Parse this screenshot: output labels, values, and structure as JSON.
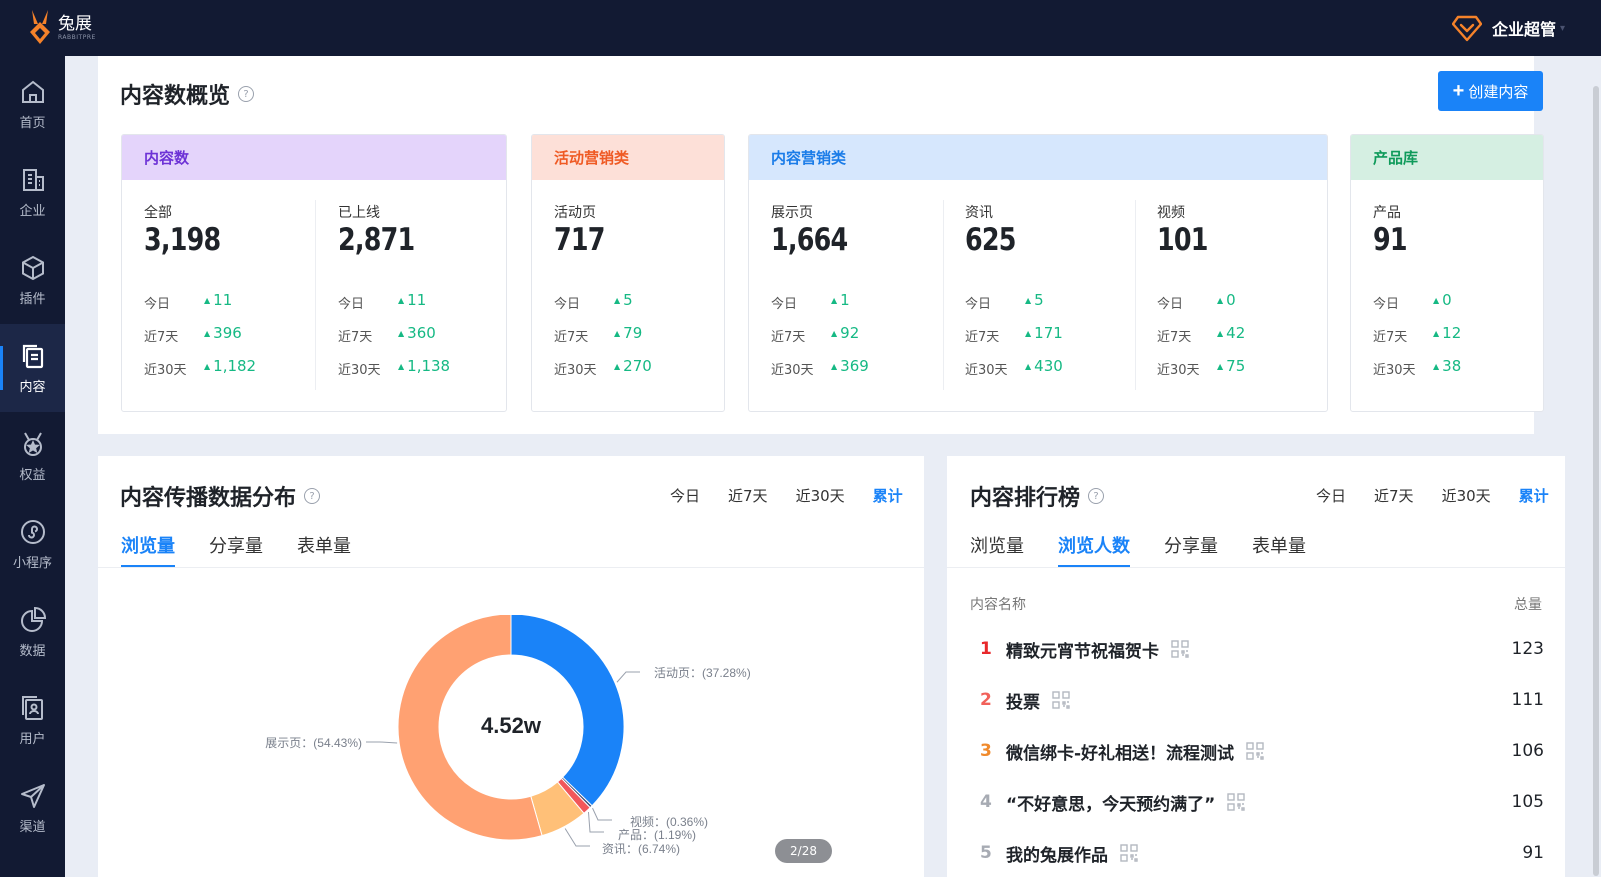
{
  "app": {
    "logo_cn": "兔展",
    "logo_en": "RABBITPRE",
    "user_role": "企业超管",
    "caret": "▾"
  },
  "sidebar": {
    "items": [
      {
        "label": "首页",
        "icon": "home-icon"
      },
      {
        "label": "企业",
        "icon": "building-icon"
      },
      {
        "label": "插件",
        "icon": "cube-icon"
      },
      {
        "label": "内容",
        "icon": "copy-icon",
        "active": true
      },
      {
        "label": "权益",
        "icon": "medal-icon"
      },
      {
        "label": "小程序",
        "icon": "miniprogram-icon"
      },
      {
        "label": "数据",
        "icon": "pie-icon"
      },
      {
        "label": "用户",
        "icon": "user-doc-icon"
      },
      {
        "label": "渠道",
        "icon": "send-icon"
      }
    ]
  },
  "overview": {
    "title": "内容数概览",
    "help": "?",
    "create_label": "创建内容",
    "create_plus": "+",
    "groups": [
      {
        "name": "内容数",
        "head_bg": "#e4d4fb",
        "head_color": "#6d32d6",
        "metrics": [
          {
            "label": "全部",
            "value": "3,198",
            "today": "11",
            "d7": "396",
            "d30": "1,182"
          },
          {
            "label": "已上线",
            "value": "2,871",
            "today": "11",
            "d7": "360",
            "d30": "1,138"
          }
        ]
      },
      {
        "name": "活动营销类",
        "head_bg": "#fde0d8",
        "head_color": "#ef5a24",
        "metrics": [
          {
            "label": "活动页",
            "value": "717",
            "today": "5",
            "d7": "79",
            "d30": "270"
          }
        ]
      },
      {
        "name": "内容营销类",
        "head_bg": "#d6e7fd",
        "head_color": "#1a7ce8",
        "metrics": [
          {
            "label": "展示页",
            "value": "1,664",
            "today": "1",
            "d7": "92",
            "d30": "369"
          },
          {
            "label": "资讯",
            "value": "625",
            "today": "5",
            "d7": "171",
            "d30": "430"
          },
          {
            "label": "视频",
            "value": "101",
            "today": "0",
            "d7": "42",
            "d30": "75"
          }
        ]
      },
      {
        "name": "产品库",
        "head_bg": "#d5efe2",
        "head_color": "#0e9a5a",
        "metrics": [
          {
            "label": "产品",
            "value": "91",
            "today": "0",
            "d7": "12",
            "d30": "38"
          }
        ]
      }
    ],
    "row_labels": {
      "today": "今日",
      "d7": "近7天",
      "d30": "近30天"
    }
  },
  "spread": {
    "title": "内容传播数据分布",
    "periods": [
      "今日",
      "近7天",
      "近30天",
      "累计"
    ],
    "selected_period": "累计",
    "tabs": [
      "浏览量",
      "分享量",
      "表单量"
    ],
    "selected_tab": "浏览量",
    "center_value": "4.52w",
    "pager": "2/28"
  },
  "chart_data": {
    "type": "pie",
    "title": "",
    "slices": [
      {
        "name": "活动页",
        "label": "活动页：(37.28%)",
        "value": 37.28,
        "color": "#1a83f8"
      },
      {
        "name": "视频",
        "label": "视频：(0.36%)",
        "value": 0.36,
        "color": "#3a4a73"
      },
      {
        "name": "产品",
        "label": "产品：(1.19%)",
        "value": 1.19,
        "color": "#f2575a"
      },
      {
        "name": "资讯",
        "label": "资讯：(6.74%)",
        "value": 6.74,
        "color": "#ffc078"
      },
      {
        "name": "展示页",
        "label": "展示页：(54.43%)",
        "value": 54.43,
        "color": "#ffa172"
      }
    ]
  },
  "rank": {
    "title": "内容排行榜",
    "periods": [
      "今日",
      "近7天",
      "近30天",
      "累计"
    ],
    "selected_period": "累计",
    "tabs": [
      "浏览量",
      "浏览人数",
      "分享量",
      "表单量"
    ],
    "selected_tab": "浏览人数",
    "col_name": "内容名称",
    "col_total": "总量",
    "rows": [
      {
        "rank": "1",
        "title": "精致元宵节祝福贺卡",
        "value": "123",
        "color": "#e8282b"
      },
      {
        "rank": "2",
        "title": "投票",
        "value": "111",
        "color": "#f1615a"
      },
      {
        "rank": "3",
        "title": "微信绑卡-好礼相送！流程测试",
        "value": "106",
        "color": "#f08a2c"
      },
      {
        "rank": "4",
        "title": "“不好意思，今天预约满了”",
        "value": "105",
        "color": "#a7abb3"
      },
      {
        "rank": "5",
        "title": "我的兔展作品",
        "value": "91",
        "color": "#a7abb3"
      }
    ]
  }
}
